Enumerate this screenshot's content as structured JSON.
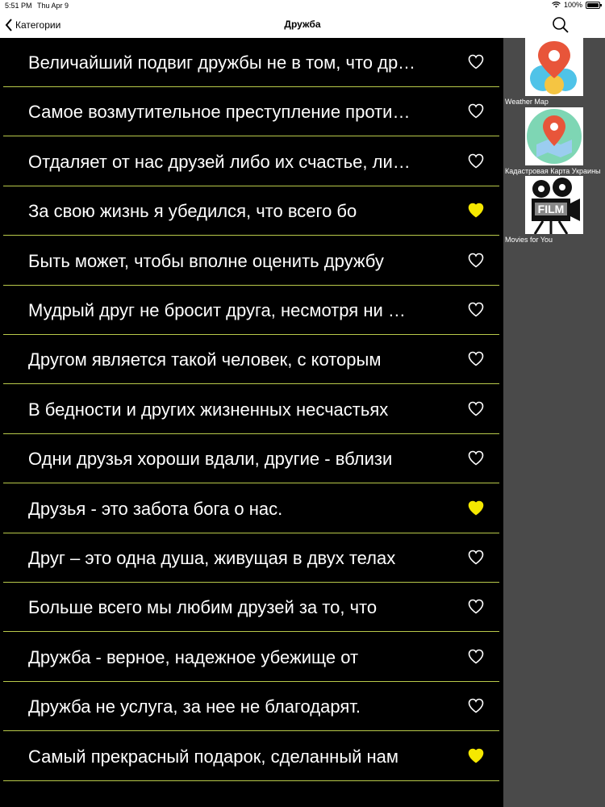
{
  "status": {
    "time": "5:51 PM",
    "date": "Thu Apr 9",
    "battery": "100%"
  },
  "nav": {
    "back_label": "Категории",
    "title": "Дружба"
  },
  "quotes": [
    {
      "text": "Величайший подвиг дружбы не в том, что друг показывает свои недостатки другу",
      "favorite": false
    },
    {
      "text": "Самое возмутительное преступление против дружбы",
      "favorite": false
    },
    {
      "text": "Отдаляет от нас друзей либо их счастье, либо наше несчастье",
      "favorite": false
    },
    {
      "text": "За свою жизнь я убедился, что всего бо",
      "favorite": true
    },
    {
      "text": "Быть может, чтобы вполне оценить дружбу",
      "favorite": false
    },
    {
      "text": "Мудрый друг не бросит друга, несмотря ни на что",
      "favorite": false
    },
    {
      "text": "Другом является такой человек, с которым",
      "favorite": false
    },
    {
      "text": "В бедности и других жизненных несчастьях",
      "favorite": false
    },
    {
      "text": "Одни друзья хороши вдали, другие - вблизи",
      "favorite": false
    },
    {
      "text": "Друзья - это забота бога о нас.",
      "favorite": true
    },
    {
      "text": "Друг – это одна душа, живущая в двух телах",
      "favorite": false
    },
    {
      "text": "Больше всего мы любим друзей за то, что",
      "favorite": false
    },
    {
      "text": "Дружба - верное, надежное убежище от",
      "favorite": false
    },
    {
      "text": "Дружба не услуга, за нее не благодарят.",
      "favorite": false
    },
    {
      "text": "Самый прекрасный подарок, сделанный нам",
      "favorite": true
    }
  ],
  "ads": [
    {
      "label": "Weather Map",
      "icon": "weather-map-icon"
    },
    {
      "label": "Кадастровая Карта Украины",
      "icon": "cadastral-map-icon"
    },
    {
      "label": "Movies for You",
      "icon": "film-camera-icon"
    }
  ],
  "colors": {
    "favorite": "#f5e800",
    "separator": "#b8c94a",
    "sidebar": "#4a4a4a"
  }
}
